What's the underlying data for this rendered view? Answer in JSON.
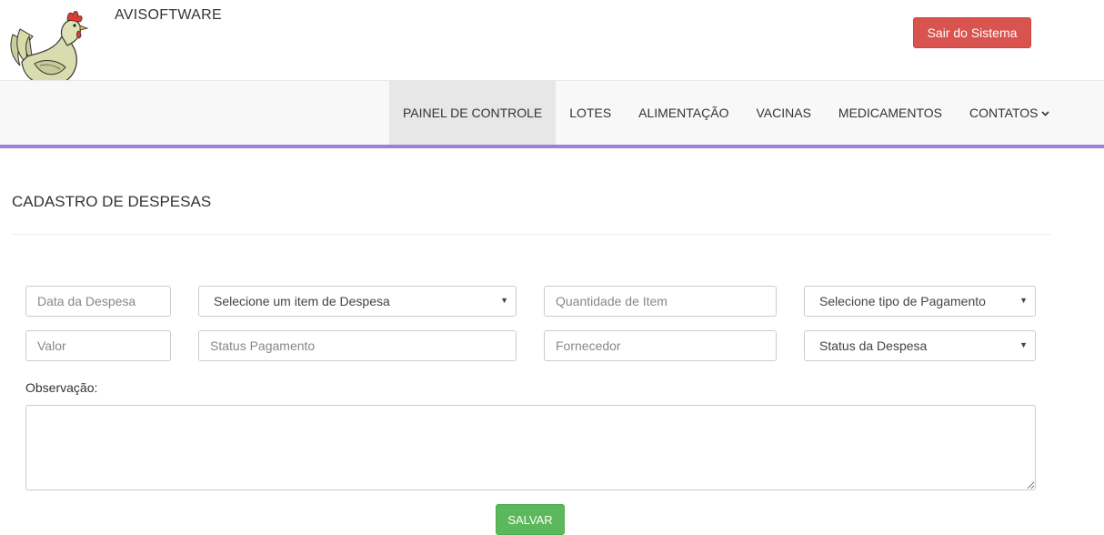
{
  "header": {
    "brand": "AVISOFTWARE",
    "logo_icon": "chicken-icon",
    "logout_label": "Sair do Sistema"
  },
  "nav": {
    "items": [
      {
        "label": "PAINEL DE CONTROLE",
        "active": true
      },
      {
        "label": "LOTES",
        "active": false
      },
      {
        "label": "ALIMENTAÇÃO",
        "active": false
      },
      {
        "label": "VACINAS",
        "active": false
      },
      {
        "label": "MEDICAMENTOS",
        "active": false
      },
      {
        "label": "CONTATOS",
        "active": false,
        "has_dropdown": true
      }
    ],
    "dropdown_icon": "chevron-down-icon"
  },
  "page": {
    "title": "CADASTRO DE DESPESAS"
  },
  "form": {
    "data_despesa_placeholder": "Data da Despesa",
    "item_despesa_selected": "Selecione um item de Despesa",
    "quantidade_placeholder": "Quantidade de Item",
    "tipo_pagamento_selected": "Selecione tipo de Pagamento",
    "valor_placeholder": "Valor",
    "status_pagamento_placeholder": "Status Pagamento",
    "fornecedor_placeholder": "Fornecedor",
    "status_despesa_selected": "Status da Despesa",
    "observacao_label": "Observação:",
    "observacao_value": "",
    "save_label": "SALVAR"
  },
  "colors": {
    "danger": "#d9534f",
    "success": "#5cb85c",
    "nav_accent": "#9c7fe0",
    "nav_bg": "#f8f8f8",
    "nav_active_bg": "#e7e7e7"
  }
}
